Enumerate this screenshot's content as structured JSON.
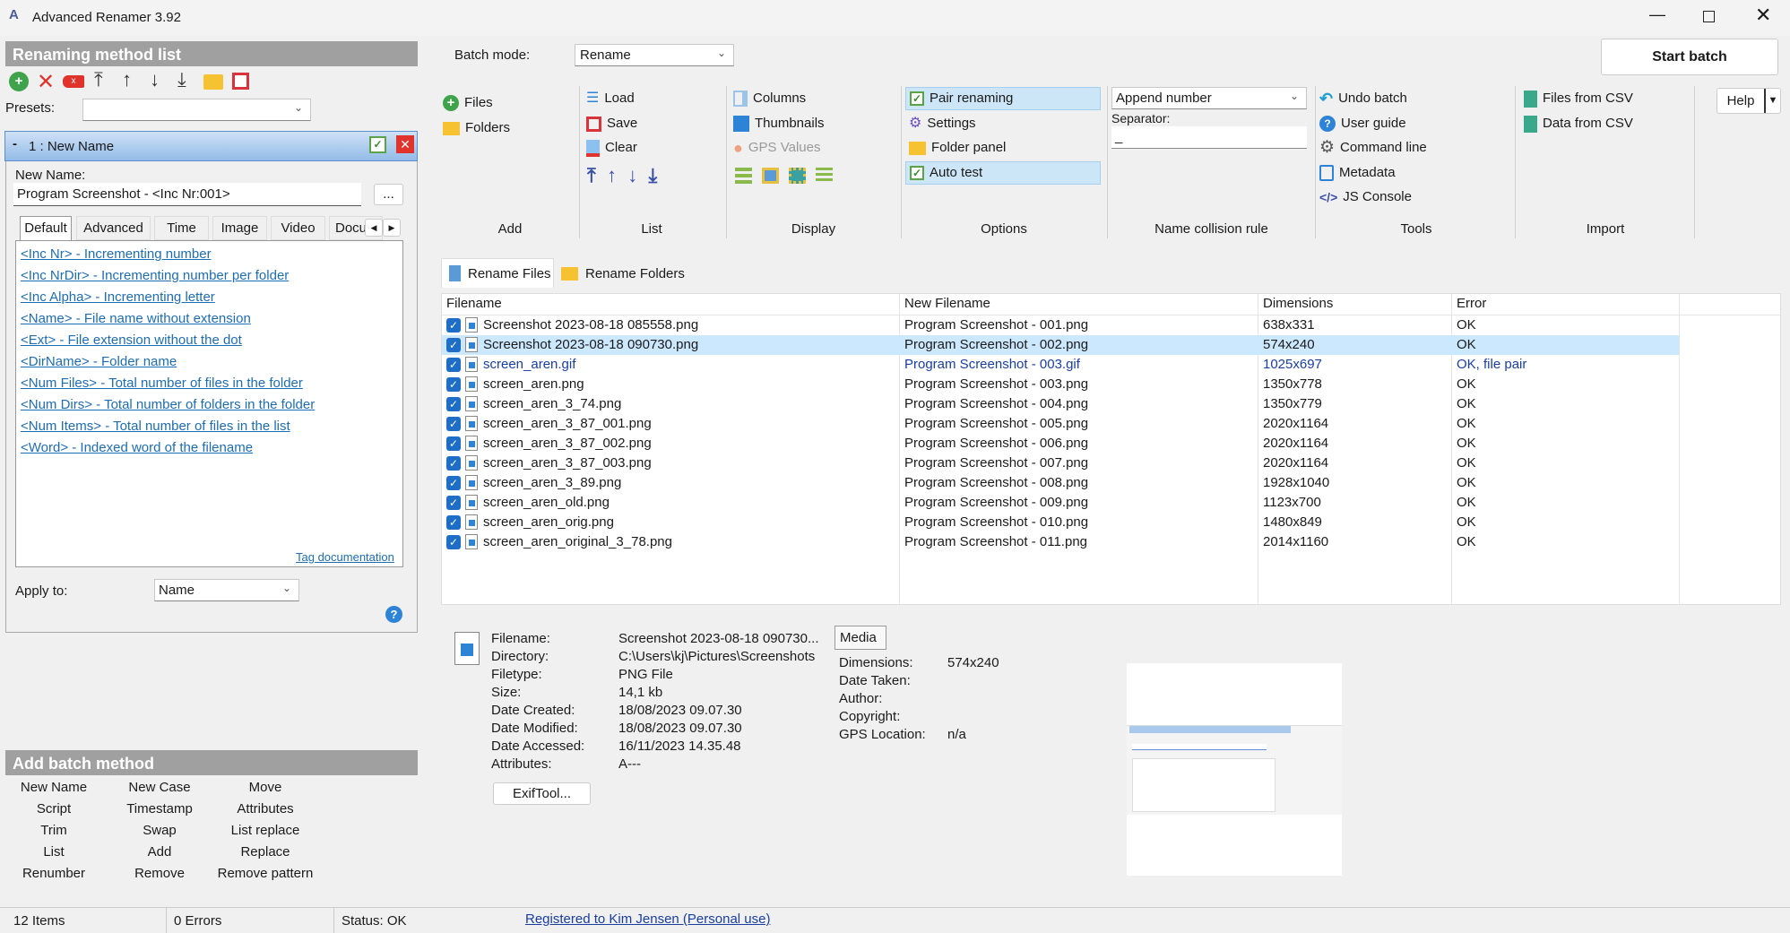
{
  "window": {
    "title": "Advanced Renamer 3.92",
    "controls": [
      "minimize",
      "maximize",
      "close"
    ]
  },
  "left": {
    "method_list_title": "Renaming method list",
    "toolbar_icons": [
      "add-icon",
      "delete-icon",
      "clear-icon",
      "move-top-icon",
      "move-up-icon",
      "move-down-icon",
      "move-bottom-icon",
      "open-folder-icon",
      "save-icon"
    ],
    "presets_label": "Presets:",
    "presets_value": "",
    "method": {
      "title": "1 : New Name",
      "new_name_label": "New Name:",
      "new_name_value": "Program Screenshot - <Inc Nr:001>",
      "ellipsis": "...",
      "tabs": [
        "Default",
        "Advanced",
        "Time",
        "Image",
        "Video",
        "Docu"
      ],
      "active_tab": "Default",
      "tags": [
        "<Inc Nr> - Incrementing number",
        "<Inc NrDir> - Incrementing number per folder",
        "<Inc Alpha> - Incrementing letter",
        "<Name> - File name without extension",
        "<Ext> - File extension without the dot",
        "<DirName> - Folder name",
        "<Num Files> - Total number of files in the folder",
        "<Num Dirs> - Total number of folders in the folder",
        "<Num Items> - Total number of files in the list",
        "<Word> - Indexed word of the filename"
      ],
      "tag_doc": "Tag documentation",
      "apply_to_label": "Apply to:",
      "apply_to_value": "Name",
      "help": "?"
    },
    "add_batch_title": "Add batch method",
    "batch_methods": [
      [
        "New Name",
        "New Case",
        "Move"
      ],
      [
        "Script",
        "Timestamp",
        "Attributes"
      ],
      [
        "Trim",
        "Swap",
        "List replace"
      ],
      [
        "List",
        "Add",
        "Replace"
      ],
      [
        "Renumber",
        "Remove",
        "Remove pattern"
      ]
    ]
  },
  "top": {
    "batch_mode_label": "Batch mode:",
    "batch_mode_value": "Rename",
    "start_batch": "Start batch",
    "help": "Help"
  },
  "ribbon": {
    "add": {
      "label": "Add",
      "items": [
        "Files",
        "Folders"
      ]
    },
    "list": {
      "label": "List",
      "items": [
        "Load",
        "Save",
        "Clear"
      ]
    },
    "display": {
      "label": "Display",
      "items": [
        "Columns",
        "Thumbnails",
        "GPS Values"
      ]
    },
    "options": {
      "label": "Options",
      "items": [
        "Pair renaming",
        "Settings",
        "Folder panel",
        "Auto test"
      ],
      "checked": [
        "Pair renaming",
        "Auto test"
      ]
    },
    "collision": {
      "label": "Name collision rule",
      "value": "Append number",
      "separator_label": "Separator:",
      "separator_value": "_"
    },
    "tools": {
      "label": "Tools",
      "items": [
        "Undo batch",
        "User guide",
        "Command line",
        "Metadata",
        "JS Console"
      ]
    },
    "import": {
      "label": "Import",
      "items": [
        "Files from CSV",
        "Data from CSV"
      ]
    }
  },
  "file_tabs": [
    "Rename Files",
    "Rename Folders"
  ],
  "table": {
    "columns": [
      "Filename",
      "New Filename",
      "Dimensions",
      "Error"
    ],
    "selected_row": 1,
    "rows": [
      [
        "Screenshot 2023-08-18 085558.png",
        "Program Screenshot - 001.png",
        "638x331",
        "OK"
      ],
      [
        "Screenshot 2023-08-18 090730.png",
        "Program Screenshot - 002.png",
        "574x240",
        "OK"
      ],
      [
        "screen_aren.gif",
        "Program Screenshot - 003.gif",
        "1025x697",
        "OK, file pair"
      ],
      [
        "screen_aren.png",
        "Program Screenshot - 003.png",
        "1350x778",
        "OK"
      ],
      [
        "screen_aren_3_74.png",
        "Program Screenshot - 004.png",
        "1350x779",
        "OK"
      ],
      [
        "screen_aren_3_87_001.png",
        "Program Screenshot - 005.png",
        "2020x1164",
        "OK"
      ],
      [
        "screen_aren_3_87_002.png",
        "Program Screenshot - 006.png",
        "2020x1164",
        "OK"
      ],
      [
        "screen_aren_3_87_003.png",
        "Program Screenshot - 007.png",
        "2020x1164",
        "OK"
      ],
      [
        "screen_aren_3_89.png",
        "Program Screenshot - 008.png",
        "1928x1040",
        "OK"
      ],
      [
        "screen_aren_old.png",
        "Program Screenshot - 009.png",
        "1123x700",
        "OK"
      ],
      [
        "screen_aren_orig.png",
        "Program Screenshot - 010.png",
        "1480x849",
        "OK"
      ],
      [
        "screen_aren_original_3_78.png",
        "Program Screenshot - 011.png",
        "2014x1160",
        "OK"
      ]
    ]
  },
  "details": {
    "fields": [
      [
        "Filename:",
        "Screenshot 2023-08-18 090730..."
      ],
      [
        "Directory:",
        "C:\\Users\\kj\\Pictures\\Screenshots"
      ],
      [
        "Filetype:",
        "PNG File"
      ],
      [
        "Size:",
        "14,1 kb"
      ],
      [
        "Date Created:",
        "18/08/2023 09.07.30"
      ],
      [
        "Date Modified:",
        "18/08/2023 09.07.30"
      ],
      [
        "Date Accessed:",
        "16/11/2023 14.35.48"
      ],
      [
        "Attributes:",
        "A---"
      ]
    ],
    "exiftool": "ExifTool...",
    "media_tab": "Media",
    "media": [
      [
        "Dimensions:",
        "574x240"
      ],
      [
        "Date Taken:",
        ""
      ],
      [
        "Author:",
        ""
      ],
      [
        "Copyright:",
        ""
      ],
      [
        "GPS Location:",
        "n/a"
      ]
    ]
  },
  "status": {
    "items": "12 Items",
    "errors": "0 Errors",
    "status": "Status: OK",
    "registered": "Registered to Kim Jensen (Personal use)"
  },
  "colors": {
    "accent": "#1e6ec8",
    "selected_row": "#cce8ff",
    "header_gray": "#a0a0a0",
    "link": "#1f6cb0"
  }
}
